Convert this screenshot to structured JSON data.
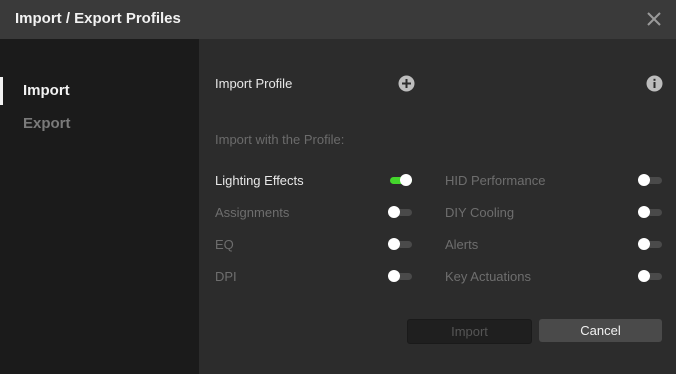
{
  "dialog": {
    "title": "Import / Export Profiles"
  },
  "sidebar": {
    "items": [
      {
        "label": "Import",
        "selected": true
      },
      {
        "label": "Export",
        "selected": false
      }
    ]
  },
  "main": {
    "import_profile_label": "Import Profile",
    "section_label": "Import with the Profile:",
    "options_left": [
      {
        "label": "Lighting Effects",
        "enabled": true
      },
      {
        "label": "Assignments",
        "enabled": false
      },
      {
        "label": "EQ",
        "enabled": false
      },
      {
        "label": "DPI",
        "enabled": false
      }
    ],
    "options_right": [
      {
        "label": "HID Performance",
        "enabled": false
      },
      {
        "label": "DIY Cooling",
        "enabled": false
      },
      {
        "label": "Alerts",
        "enabled": false
      },
      {
        "label": "Key Actuations",
        "enabled": false
      }
    ]
  },
  "buttons": {
    "import_label": "Import",
    "cancel_label": "Cancel"
  },
  "colors": {
    "accent": "#44d62c",
    "background": "#2c2c2c",
    "sidebar": "#1b1b1b",
    "titlebar": "#3a3a3a"
  },
  "icons": {
    "close": "close-icon",
    "add": "plus-circle-icon",
    "info": "info-icon"
  }
}
